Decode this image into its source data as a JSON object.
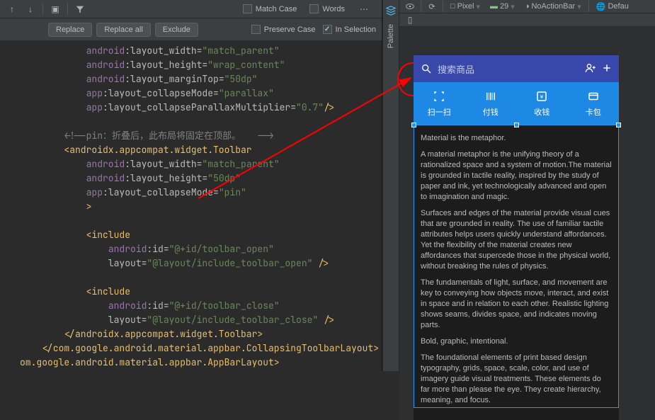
{
  "find": {
    "replace": "Replace",
    "replace_all": "Replace all",
    "exclude": "Exclude",
    "match_case": "Match Case",
    "words": "Words",
    "preserve_case": "Preserve Case",
    "in_selection": "In Selection"
  },
  "code_lines": [
    {
      "indent": 3,
      "tokens": [
        {
          "t": "ns",
          "v": "android"
        },
        {
          "t": "attr",
          "v": ":layout_width="
        },
        {
          "t": "str",
          "v": "\"match_parent\""
        }
      ]
    },
    {
      "indent": 3,
      "tokens": [
        {
          "t": "ns",
          "v": "android"
        },
        {
          "t": "attr",
          "v": ":layout_height="
        },
        {
          "t": "str",
          "v": "\"wrap_content\""
        }
      ]
    },
    {
      "indent": 3,
      "tokens": [
        {
          "t": "ns",
          "v": "android"
        },
        {
          "t": "attr",
          "v": ":layout_marginTop="
        },
        {
          "t": "str",
          "v": "\"50dp\""
        }
      ]
    },
    {
      "indent": 3,
      "tokens": [
        {
          "t": "ns",
          "v": "app"
        },
        {
          "t": "attr",
          "v": ":layout_collapseMode="
        },
        {
          "t": "str",
          "v": "\"parallax\""
        }
      ]
    },
    {
      "indent": 3,
      "tokens": [
        {
          "t": "ns",
          "v": "app"
        },
        {
          "t": "attr",
          "v": ":layout_collapseParallaxMultiplier="
        },
        {
          "t": "str",
          "v": "\"0.7\""
        },
        {
          "t": "tag",
          "v": "/>"
        }
      ]
    },
    {
      "indent": 0,
      "tokens": []
    },
    {
      "indent": 2,
      "tokens": [
        {
          "t": "cmt",
          "v": "<!--pin：折叠后，此布局将固定在顶部。   -->"
        }
      ]
    },
    {
      "indent": 2,
      "tokens": [
        {
          "t": "tag",
          "v": "<androidx.appcompat.widget.Toolbar"
        }
      ]
    },
    {
      "indent": 3,
      "tokens": [
        {
          "t": "ns",
          "v": "android"
        },
        {
          "t": "attr",
          "v": ":layout_width="
        },
        {
          "t": "str",
          "v": "\"match_parent\""
        }
      ]
    },
    {
      "indent": 3,
      "tokens": [
        {
          "t": "ns",
          "v": "android"
        },
        {
          "t": "attr",
          "v": ":layout_height="
        },
        {
          "t": "str",
          "v": "\"50dp\""
        }
      ]
    },
    {
      "indent": 3,
      "tokens": [
        {
          "t": "ns",
          "v": "app"
        },
        {
          "t": "attr",
          "v": ":layout_collapseMode="
        },
        {
          "t": "str",
          "v": "\"pin\""
        }
      ]
    },
    {
      "indent": 3,
      "tokens": [
        {
          "t": "tag",
          "v": ">"
        }
      ]
    },
    {
      "indent": 0,
      "tokens": []
    },
    {
      "indent": 3,
      "tokens": [
        {
          "t": "tag",
          "v": "<include"
        }
      ]
    },
    {
      "indent": 4,
      "tokens": [
        {
          "t": "ns",
          "v": "android"
        },
        {
          "t": "attr",
          "v": ":id="
        },
        {
          "t": "str",
          "v": "\"@+id/toolbar_open\""
        }
      ]
    },
    {
      "indent": 4,
      "tokens": [
        {
          "t": "attr",
          "v": "layout="
        },
        {
          "t": "str",
          "v": "\"@layout/include_toolbar_open\""
        },
        {
          "t": "attr",
          "v": " "
        },
        {
          "t": "tag",
          "v": "/>"
        }
      ]
    },
    {
      "indent": 0,
      "tokens": []
    },
    {
      "indent": 3,
      "tokens": [
        {
          "t": "tag",
          "v": "<include"
        }
      ]
    },
    {
      "indent": 4,
      "tokens": [
        {
          "t": "ns",
          "v": "android"
        },
        {
          "t": "attr",
          "v": ":id="
        },
        {
          "t": "str",
          "v": "\"@+id/toolbar_close\""
        }
      ]
    },
    {
      "indent": 4,
      "tokens": [
        {
          "t": "attr",
          "v": "layout="
        },
        {
          "t": "str",
          "v": "\"@layout/include_toolbar_close\""
        },
        {
          "t": "attr",
          "v": " "
        },
        {
          "t": "tag",
          "v": "/>"
        }
      ]
    },
    {
      "indent": 2,
      "tokens": [
        {
          "t": "tag",
          "v": "</androidx.appcompat.widget.Toolbar>"
        }
      ]
    },
    {
      "indent": 1,
      "tokens": [
        {
          "t": "tag",
          "v": "</com.google.android.material.appbar.CollapsingToolbarLayout>"
        }
      ]
    },
    {
      "indent": 0,
      "tokens": [
        {
          "t": "tag",
          "v": "om.google.android.material.appbar.AppBarLayout>"
        }
      ]
    }
  ],
  "palette": {
    "label": "Palette"
  },
  "preview_toolbar": {
    "device": "Pixel",
    "api": "29",
    "theme": "NoActionBar",
    "locale": "Defau"
  },
  "phone": {
    "search_placeholder": "搜索商品",
    "actions": [
      {
        "label": "扫一扫"
      },
      {
        "label": "付钱"
      },
      {
        "label": "收钱"
      },
      {
        "label": "卡包"
      }
    ],
    "text": {
      "p1": "Material is the metaphor.",
      "p2": " A material metaphor is the unifying theory of a rationalized space and a system of motion.The material is grounded in tactile reality, inspired by the study of paper and ink, yet technologically advanced and open to imagination and magic.",
      "p3": " Surfaces and edges of the material provide visual cues that are grounded in reality. The use of familiar tactile attributes helps users quickly understand affordances. Yet the flexibility of the material creates new affordances that supercede those in the physical world, without breaking the rules of physics.",
      "p4": " The fundamentals of light, surface, and movement are key to conveying how objects move, interact, and exist in space and in relation to each other. Realistic lighting shows seams, divides space, and indicates moving parts.",
      "p5": "Bold, graphic, intentional.",
      "p6": " The foundational elements of print based design typography, grids, space, scale, color, and use of imagery guide visual treatments. These elements do far more than please the eye. They create hierarchy, meaning, and focus."
    }
  }
}
